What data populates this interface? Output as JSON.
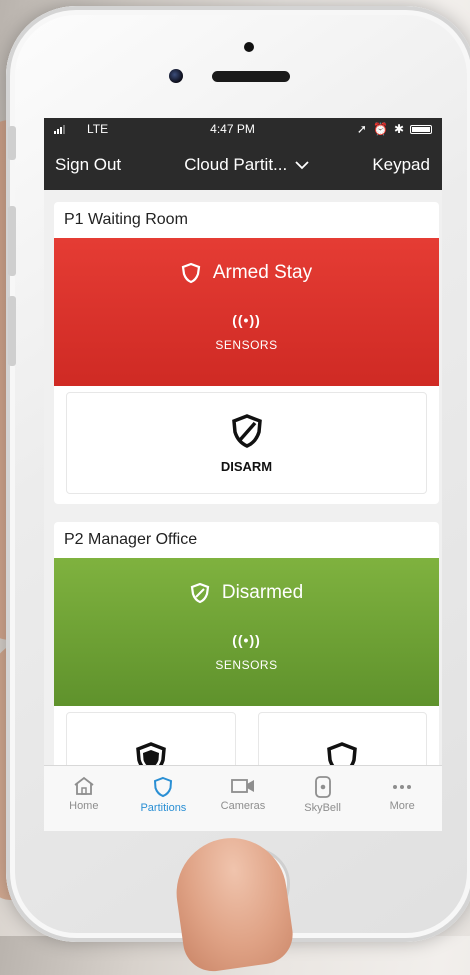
{
  "status_bar": {
    "carrier": "LTE",
    "time": "4:47 PM"
  },
  "nav_bar": {
    "left_button": "Sign Out",
    "title": "Cloud Partit...",
    "right_button": "Keypad"
  },
  "partitions": [
    {
      "name": "P1 Waiting Room",
      "state": "Armed Stay",
      "state_color": "#d9322b",
      "sensors_label": "SENSORS",
      "sensors_icon": "((•))",
      "actions": [
        {
          "label": "DISARM",
          "icon": "shield-slash-icon"
        }
      ]
    },
    {
      "name": "P2 Manager Office",
      "state": "Disarmed",
      "state_color": "#6fa336",
      "sensors_label": "SENSORS",
      "sensors_icon": "((•))",
      "actions": [
        {
          "label": "",
          "icon": "shield-filled-icon"
        },
        {
          "label": "",
          "icon": "shield-outline-icon"
        }
      ]
    }
  ],
  "tab_bar": {
    "items": [
      {
        "label": "Home",
        "icon": "home-icon",
        "active": false
      },
      {
        "label": "Partitions",
        "icon": "shield-icon",
        "active": true
      },
      {
        "label": "Cameras",
        "icon": "camera-icon",
        "active": false
      },
      {
        "label": "SkyBell",
        "icon": "doorbell-icon",
        "active": false
      },
      {
        "label": "More",
        "icon": "more-icon",
        "active": false
      }
    ]
  },
  "colors": {
    "accent_blue": "#2a8fd4",
    "nav_background": "#2b2b2b"
  }
}
